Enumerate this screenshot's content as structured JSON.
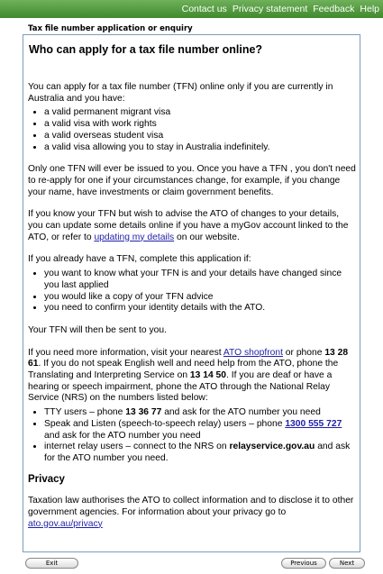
{
  "topnav": {
    "contact": "Contact us",
    "privacy": "Privacy statement",
    "feedback": "Feedback",
    "help": "Help"
  },
  "app_title": "Tax file number application or enquiry",
  "heading": "Who can apply for a tax file number online?",
  "intro": "You can apply for a tax file number (TFN) online only if you are currently in Australia and you have:",
  "eligibility": [
    "a valid permanent migrant visa",
    "a valid visa with work rights",
    "a valid overseas student visa",
    "a valid visa allowing you to stay in Australia indefinitely."
  ],
  "one_tfn": "Only one TFN will ever be issued to you. Once you have a TFN , you don't need to re-apply for one if your circumstances change, for example, if you change your name, have investments or claim government benefits.",
  "know_tfn": {
    "pre": "If you know your TFN but wish to advise the ATO of changes to your details, you can update some details online if you have a myGov account linked to the ATO, or refer to ",
    "link": "updating my details",
    "post": " on our website."
  },
  "already_have": "If you already have a TFN, complete this application if:",
  "reasons": [
    "you want to know what your TFN is and your details have changed since you last applied",
    "you would like a copy of your TFN advice",
    "you need to confirm your identity details with the ATO."
  ],
  "sent": "Your TFN will then be sent to you.",
  "more_info": {
    "pre": "If you need more information, visit your nearest ",
    "shopfront_link": "ATO shopfront",
    "mid1": " or phone ",
    "phone1": "13 28 61",
    "mid2": ". If you do not speak English well and need help from the ATO, phone the Translating and Interpreting Service on ",
    "phone2": "13 14 50",
    "post": ". If you are deaf or have a hearing or speech impairment, phone the ATO through the National Relay Service (NRS) on the numbers listed below:"
  },
  "relay": {
    "tty_pre": "TTY users – phone ",
    "tty_number": "13 36 77",
    "tty_post": " and ask for the ATO number you need",
    "ssr_pre": "Speak and Listen (speech-to-speech relay) users – phone ",
    "ssr_number": "1300 555 727",
    "ssr_post": " and ask for the ATO number you need",
    "irs_pre": "internet relay users – connect to the NRS on ",
    "irs_site": "relayservice.gov.au",
    "irs_post": " and ask for the ATO number you need."
  },
  "privacy": {
    "heading": "Privacy",
    "text": "Taxation law authorises the ATO to collect information and to disclose it to other government agencies. For information about your privacy go to ",
    "link": "ato.gov.au/privacy"
  },
  "buttons": {
    "exit": "Exit",
    "previous": "Previous",
    "next": "Next"
  },
  "colors": {
    "topbar": "#4e9a3a",
    "link": "#1f1fa8",
    "border": "#7f9db9"
  }
}
